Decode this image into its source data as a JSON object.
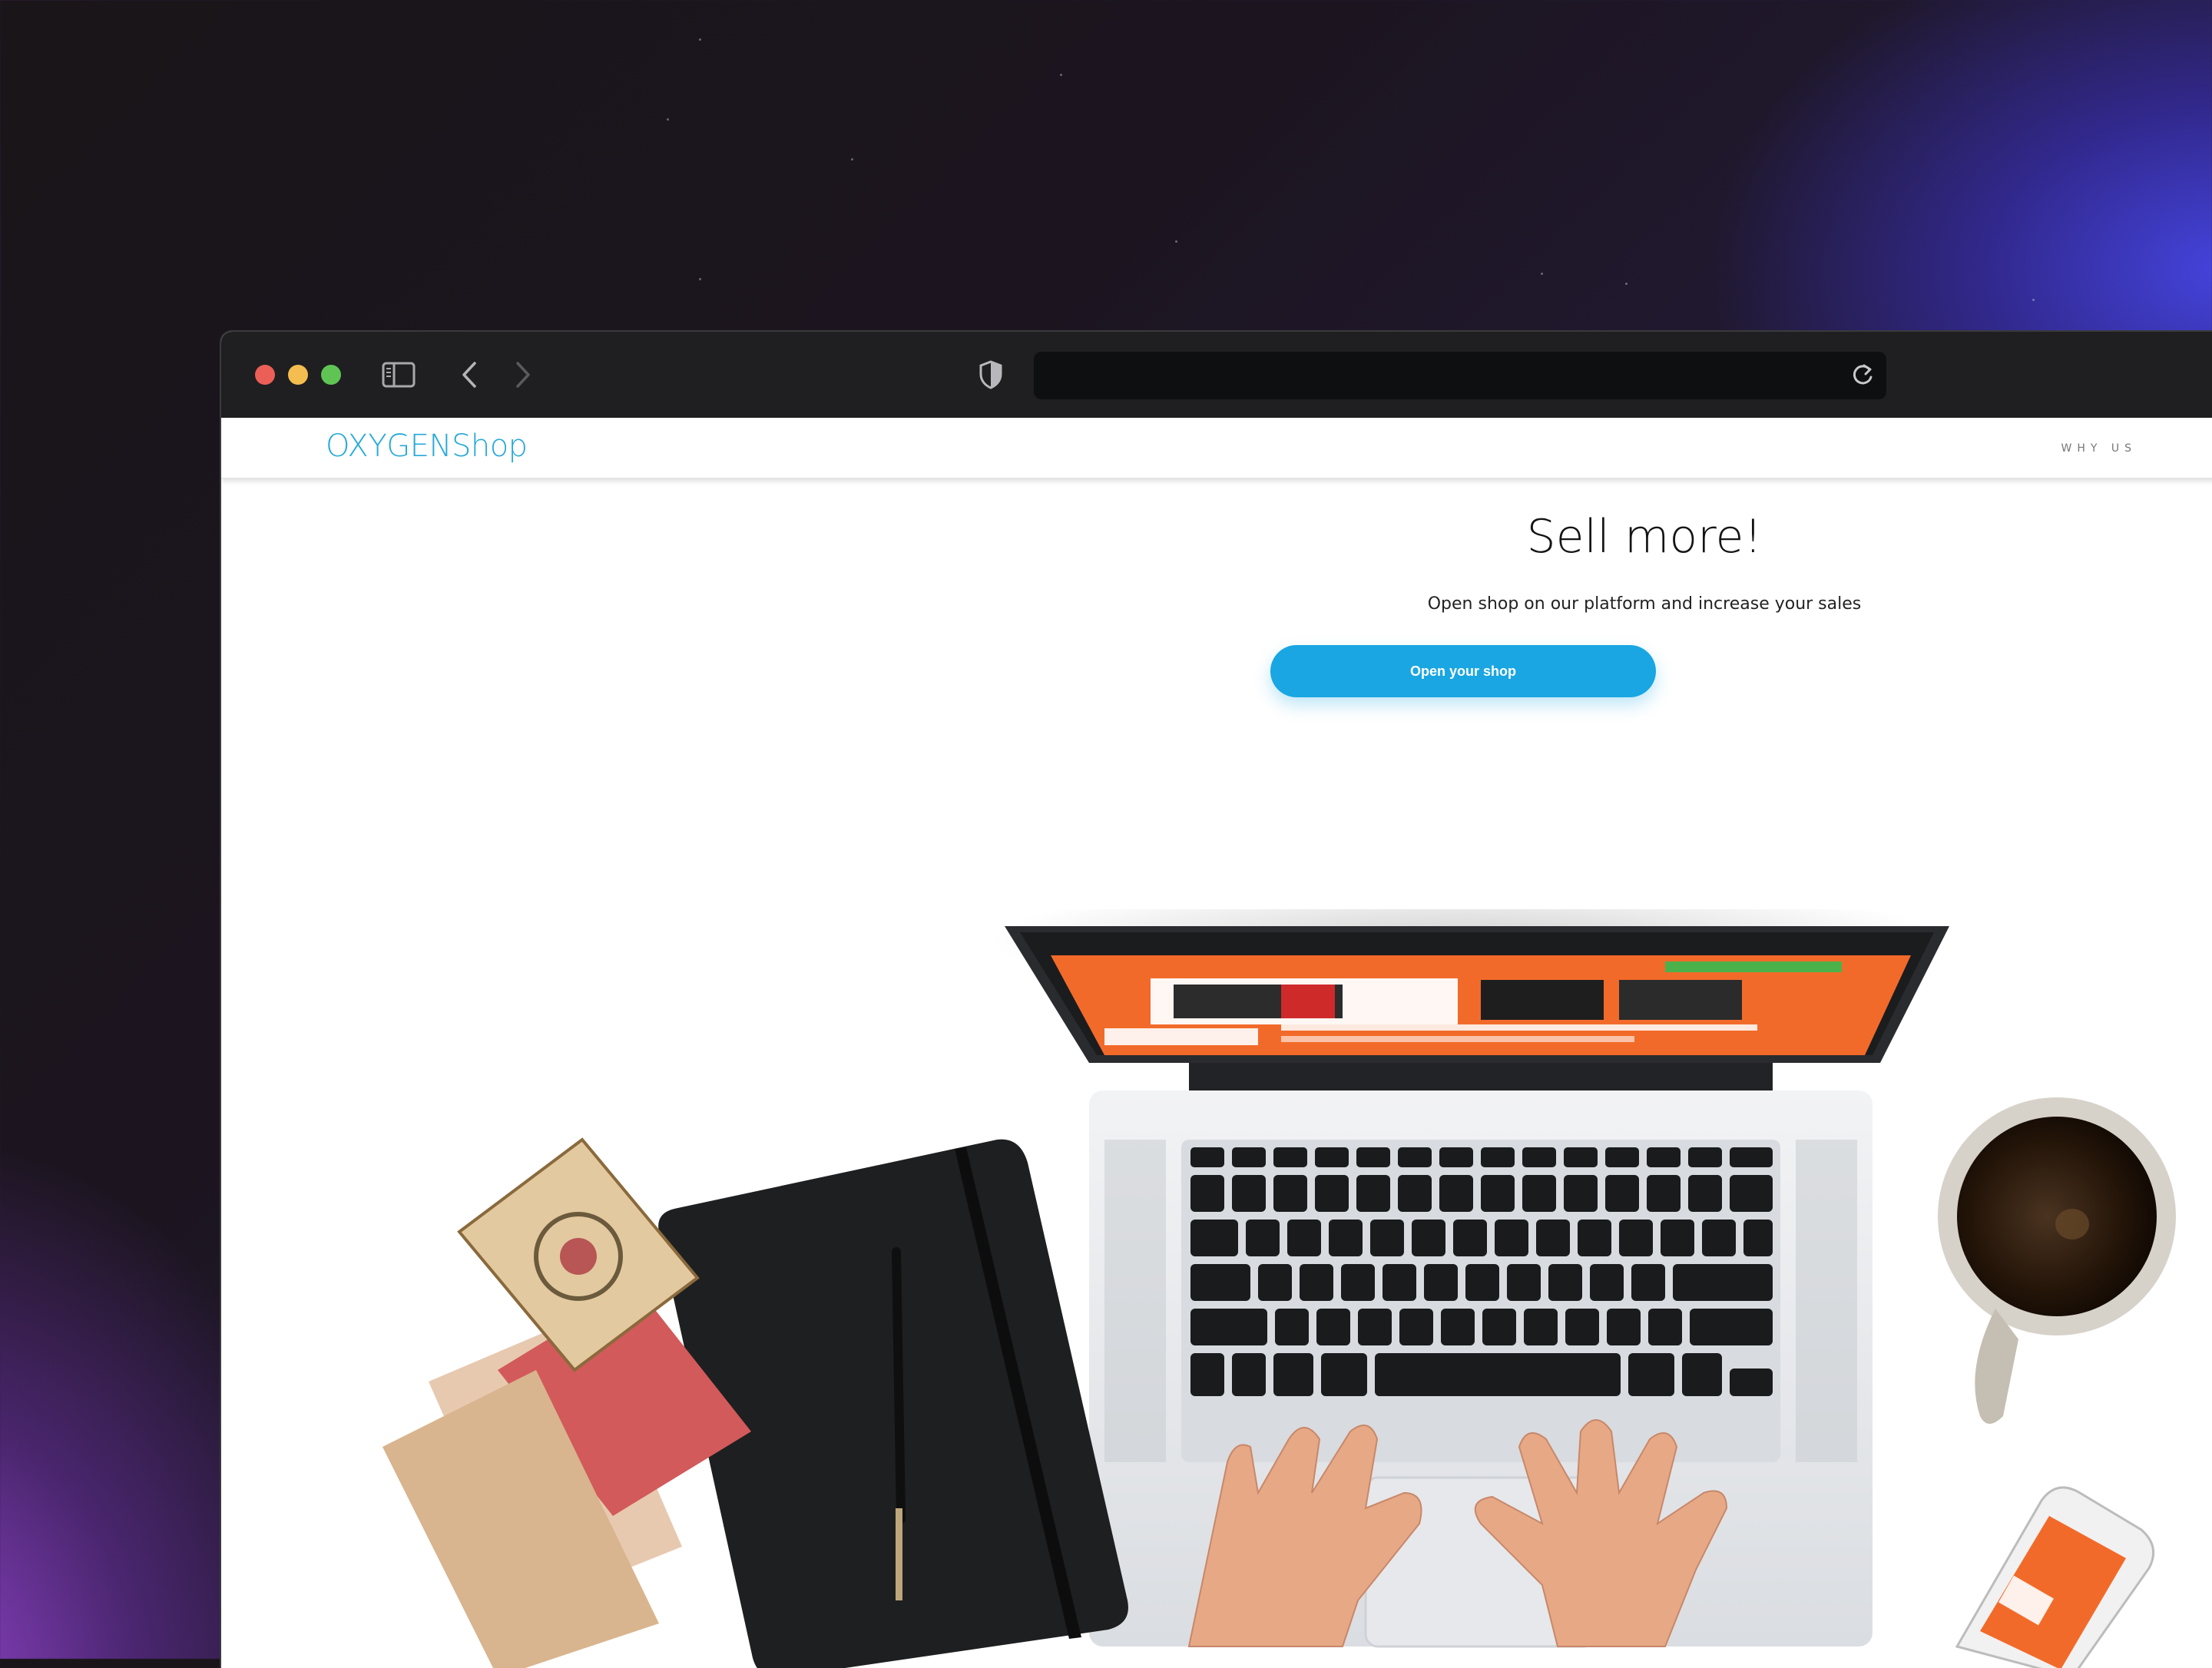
{
  "browser": {
    "address_value": "",
    "controls": [
      "close",
      "minimize",
      "zoom",
      "sidebar-icon",
      "back-icon",
      "forward-icon",
      "shield-icon",
      "reload-icon"
    ]
  },
  "site": {
    "logo": "OXYGENShop",
    "nav": {
      "why_us": "WHY US"
    },
    "hero": {
      "title": "Sell more!",
      "subtitle": "Open shop on our platform and increase your sales",
      "cta_label": "Open your shop"
    }
  },
  "colors": {
    "brand": "#28a9d8",
    "cta": "#19a6e2",
    "toolbar": "#1f1f21",
    "laptop_screen_accent": "#f26a2a"
  }
}
